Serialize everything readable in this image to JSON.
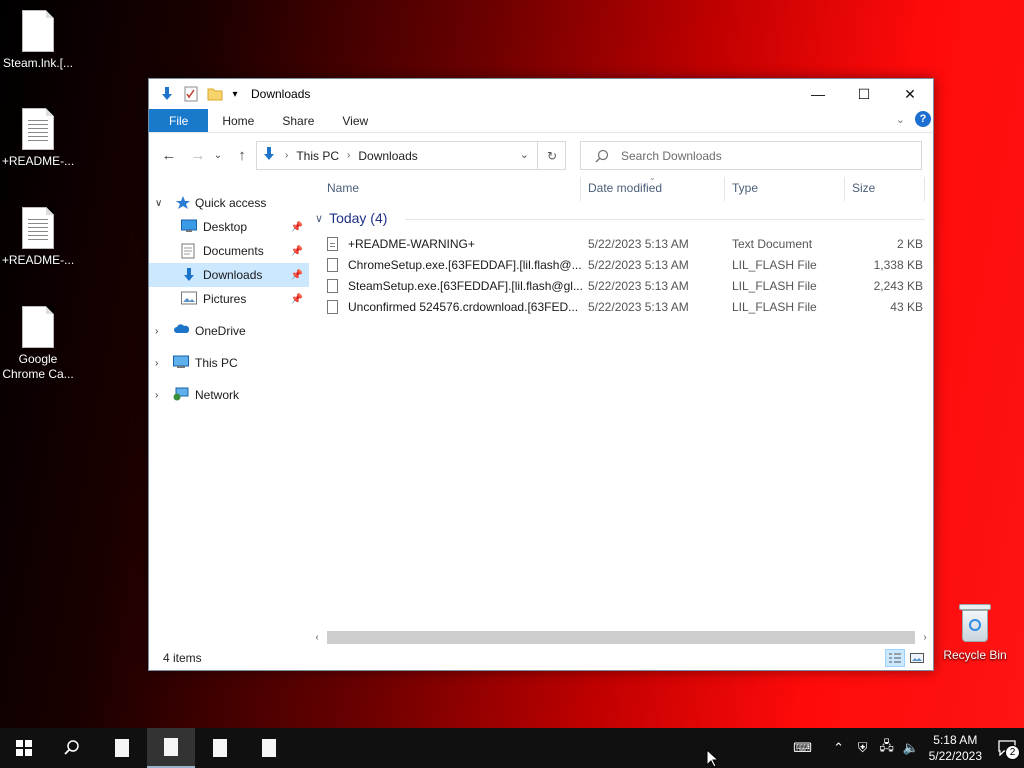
{
  "desktop": {
    "icons": [
      {
        "label": "Steam.lnk.[...",
        "icon": "document-icon"
      },
      {
        "label": "+README-...",
        "icon": "text-document-icon"
      },
      {
        "label": "+README-...",
        "icon": "text-document-icon"
      },
      {
        "label": "Google\nChrome Ca...",
        "icon": "document-icon"
      }
    ],
    "recycle_bin": "Recycle Bin"
  },
  "window": {
    "title": "Downloads",
    "controls": {
      "minimize": "—",
      "maximize": "☐",
      "close": "✕"
    },
    "ribbon_tabs": [
      "File",
      "Home",
      "Share",
      "View"
    ],
    "help": "?",
    "address": {
      "crumbs": [
        "This PC",
        "Downloads"
      ]
    },
    "search_placeholder": "Search Downloads",
    "nav": {
      "quick_access": "Quick access",
      "desktop": "Desktop",
      "documents": "Documents",
      "downloads": "Downloads",
      "pictures": "Pictures",
      "onedrive": "OneDrive",
      "this_pc": "This PC",
      "network": "Network"
    },
    "columns": {
      "name": "Name",
      "date": "Date modified",
      "type": "Type",
      "size": "Size"
    },
    "group_label": "Today (4)",
    "files": [
      {
        "name": "+README-WARNING+",
        "date": "5/22/2023 5:13 AM",
        "type": "Text Document",
        "size": "2 KB"
      },
      {
        "name": "ChromeSetup.exe.[63FEDDAF].[lil.flash@...",
        "date": "5/22/2023 5:13 AM",
        "type": "LIL_FLASH File",
        "size": "1,338 KB"
      },
      {
        "name": "SteamSetup.exe.[63FEDDAF].[lil.flash@gl...",
        "date": "5/22/2023 5:13 AM",
        "type": "LIL_FLASH File",
        "size": "2,243 KB"
      },
      {
        "name": "Unconfirmed 524576.crdownload.[63FED...",
        "date": "5/22/2023 5:13 AM",
        "type": "LIL_FLASH File",
        "size": "43 KB"
      }
    ],
    "status": "4 items"
  },
  "taskbar": {
    "time": "5:18 AM",
    "date": "5/22/2023",
    "notification_count": "2"
  },
  "colors": {
    "accent": "#1979ca",
    "selection": "#cce8ff",
    "group_text": "#1e3287"
  }
}
